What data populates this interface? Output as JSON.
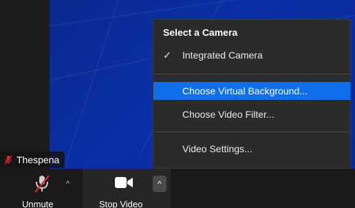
{
  "participant": {
    "name": "Thespena"
  },
  "camera_menu": {
    "header": "Select a Camera",
    "items": [
      {
        "label": "Integrated Camera",
        "checked": true,
        "highlighted": false
      },
      {
        "label": "Choose Virtual Background...",
        "checked": false,
        "highlighted": true
      },
      {
        "label": "Choose Video Filter...",
        "checked": false,
        "highlighted": false
      },
      {
        "label": "Video Settings...",
        "checked": false,
        "highlighted": false
      }
    ]
  },
  "toolbar": {
    "unmute_label": "Unmute",
    "stop_video_label": "Stop Video",
    "caret": "^"
  },
  "colors": {
    "highlight": "#0e71eb",
    "mute_red": "#e02828",
    "background": "#0b2fa6"
  },
  "icons": [
    "microphone-muted-icon",
    "video-camera-icon",
    "check-icon",
    "chevron-up-icon"
  ]
}
